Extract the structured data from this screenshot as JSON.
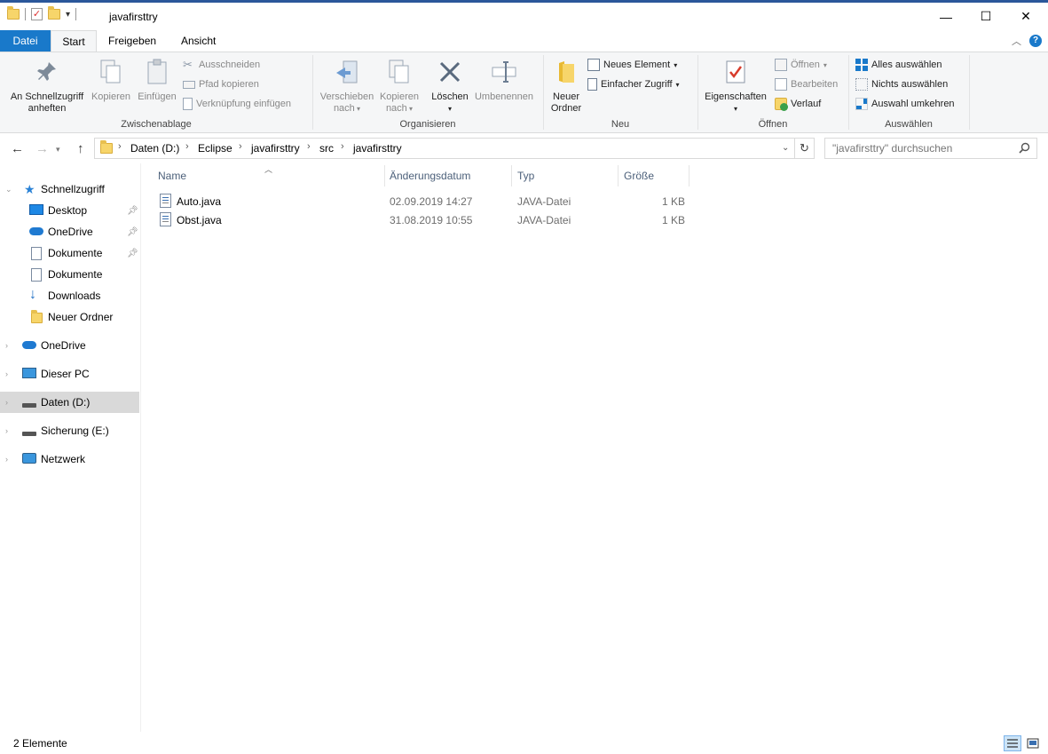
{
  "window": {
    "title": "javafirsttry",
    "minimize_glyph": "—",
    "maximize_glyph": "☐",
    "close_glyph": "✕"
  },
  "ribbon": {
    "tabs": [
      "Datei",
      "Start",
      "Freigeben",
      "Ansicht"
    ],
    "active_tab": "Start",
    "groups": {
      "clipboard": {
        "label": "Zwischenablage",
        "pin_label": "An Schnellzugriff anheften",
        "copy_label": "Kopieren",
        "paste_label": "Einfügen",
        "cut_label": "Ausschneiden",
        "copy_path_label": "Pfad kopieren",
        "paste_shortcut_label": "Verknüpfung einfügen"
      },
      "organize": {
        "label": "Organisieren",
        "move_label": "Verschieben nach",
        "copyto_label": "Kopieren nach",
        "delete_label": "Löschen",
        "rename_label": "Umbenennen"
      },
      "new": {
        "label": "Neu",
        "new_folder_label": "Neuer Ordner",
        "new_item_label": "Neues Element",
        "easy_access_label": "Einfacher Zugriff"
      },
      "open": {
        "label": "Öffnen",
        "properties_label": "Eigenschaften",
        "open_label": "Öffnen",
        "edit_label": "Bearbeiten",
        "history_label": "Verlauf"
      },
      "select": {
        "label": "Auswählen",
        "select_all_label": "Alles auswählen",
        "select_none_label": "Nichts auswählen",
        "invert_label": "Auswahl umkehren"
      }
    }
  },
  "address": {
    "breadcrumbs": [
      "Daten (D:)",
      "Eclipse",
      "javafirsttry",
      "src",
      "javafirsttry"
    ],
    "search_placeholder": "\"javafirsttry\" durchsuchen"
  },
  "navigation": [
    {
      "label": "Schnellzugriff",
      "icon": "star-icon",
      "level": 0,
      "pinned": false
    },
    {
      "label": "Desktop",
      "icon": "desktop-icon",
      "level": 1,
      "pinned": true
    },
    {
      "label": "OneDrive",
      "icon": "cloud-icon",
      "level": 1,
      "pinned": true
    },
    {
      "label": "Dokumente",
      "icon": "document-icon",
      "level": 1,
      "pinned": true
    },
    {
      "label": "Dokumente",
      "icon": "document-icon",
      "level": 1,
      "pinned": false
    },
    {
      "label": "Downloads",
      "icon": "download-arrow-icon",
      "level": 1,
      "pinned": false
    },
    {
      "label": "Neuer Ordner",
      "icon": "folder-icon",
      "level": 1,
      "pinned": false
    },
    {
      "label": "OneDrive",
      "icon": "cloud-icon",
      "level": 0,
      "pinned": false
    },
    {
      "label": "Dieser PC",
      "icon": "computer-icon",
      "level": 0,
      "pinned": false
    },
    {
      "label": "Daten (D:)",
      "icon": "drive-icon",
      "level": 0,
      "pinned": false,
      "selected": true
    },
    {
      "label": "Sicherung (E:)",
      "icon": "drive-icon",
      "level": 0,
      "pinned": false
    },
    {
      "label": "Netzwerk",
      "icon": "network-icon",
      "level": 0,
      "pinned": false
    }
  ],
  "file_list": {
    "columns": [
      "Name",
      "Änderungsdatum",
      "Typ",
      "Größe"
    ],
    "rows": [
      {
        "name": "Auto.java",
        "date": "02.09.2019 14:27",
        "type": "JAVA-Datei",
        "size": "1 KB"
      },
      {
        "name": "Obst.java",
        "date": "31.08.2019 10:55",
        "type": "JAVA-Datei",
        "size": "1 KB"
      }
    ]
  },
  "status": {
    "item_count": "2 Elemente"
  },
  "colors": {
    "accent": "#1979ca",
    "selection": "#d9d9d9"
  }
}
